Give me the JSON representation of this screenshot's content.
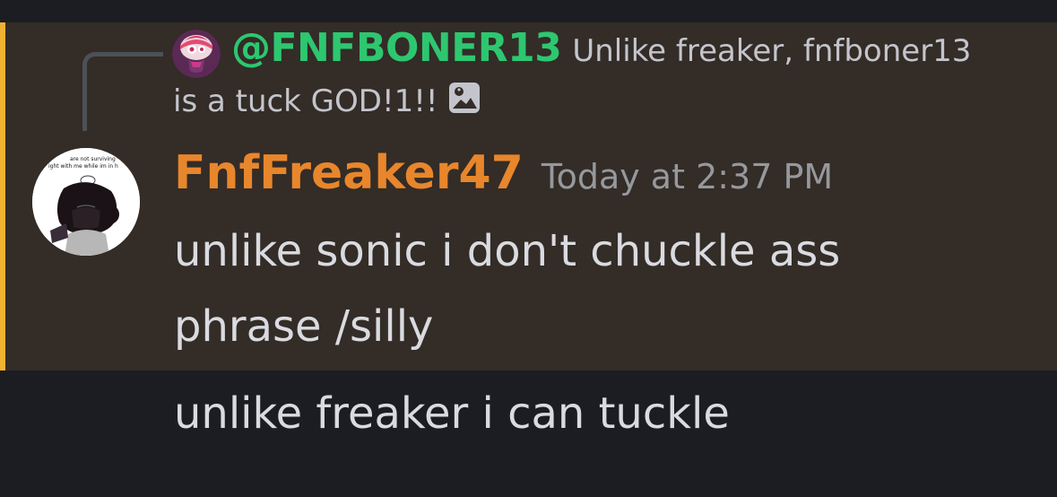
{
  "reply": {
    "author": "@FNFBONER13",
    "text_line1": "Unlike freaker, fnfboner13",
    "text_line2": "is a tuck GOD!1!!"
  },
  "message": {
    "author": "FnfFreaker47",
    "timestamp": "Today at 2:37 PM",
    "line1": "unlike sonic i don't chuckle ass",
    "line2": "phrase /silly"
  },
  "followup": {
    "text": "unlike freaker i can tuckle"
  },
  "avatar": {
    "caption_line1": "are not surviving",
    "caption_line2": "ight with me while im in h"
  },
  "colors": {
    "background": "#1c1d22",
    "highlight": "#332c27",
    "highlight_bar": "#f0b232",
    "reply_author": "#2dc770",
    "author": "#e8862c",
    "timestamp": "#96989d"
  }
}
